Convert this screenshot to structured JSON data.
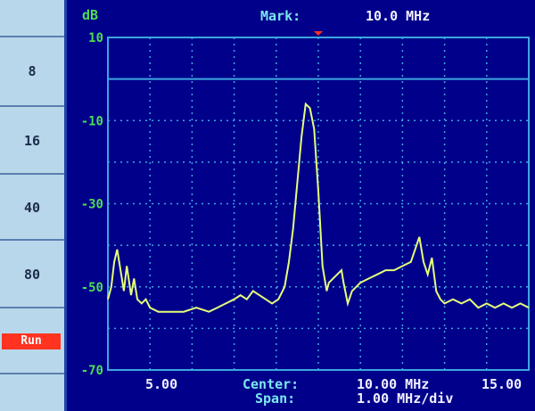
{
  "sidebar": {
    "items": [
      {
        "label": ""
      },
      {
        "label": "8"
      },
      {
        "label": "16"
      },
      {
        "label": "40"
      },
      {
        "label": "80"
      }
    ],
    "run_label": "Run"
  },
  "header": {
    "unit": "dB",
    "mark_label": "Mark:",
    "mark_value": "10.0 MHz"
  },
  "footer": {
    "x_left": "5.00",
    "center_label": "Center:",
    "center_value": "10.00 MHz",
    "x_right": "15.00",
    "span_label": "Span:",
    "span_value": "1.00 MHz/div"
  },
  "colors": {
    "background": "#00008a",
    "trace": "#e6ff7a",
    "grid": "#3ea6e0",
    "axis_label": "#4ddc55",
    "panel": "#b9d7ea",
    "run": "#ff3320"
  },
  "chart_data": {
    "type": "line",
    "ylim": [
      -70,
      10
    ],
    "xlim": [
      5,
      15
    ],
    "y_tick_labels": [
      "10",
      "-10",
      "-30",
      "-50",
      "-70"
    ],
    "y_ticks": [
      10,
      -10,
      -30,
      -50,
      -70
    ],
    "reference_level": 0,
    "marker_x": 10.0,
    "grid": true,
    "series": [
      {
        "x": [
          5.0,
          5.08,
          5.15,
          5.22,
          5.3,
          5.38,
          5.45,
          5.55,
          5.62,
          5.7,
          5.8,
          5.9,
          6.0,
          6.2,
          6.5,
          6.8,
          7.1,
          7.4,
          7.6,
          7.8,
          8.0,
          8.15,
          8.3,
          8.45,
          8.6,
          8.75,
          8.9,
          9.05,
          9.2,
          9.3,
          9.4,
          9.5,
          9.6,
          9.7,
          9.8,
          9.9,
          10.0,
          10.1,
          10.2,
          10.25,
          10.35,
          10.45,
          10.55,
          10.6,
          10.7,
          10.8,
          10.9,
          11.0,
          11.2,
          11.4,
          11.6,
          11.8,
          12.0,
          12.2,
          12.4,
          12.5,
          12.6,
          12.7,
          12.8,
          12.9,
          13.0,
          13.2,
          13.4,
          13.6,
          13.8,
          14.0,
          14.2,
          14.4,
          14.6,
          14.8,
          15.0
        ],
        "y": [
          -53,
          -50,
          -44,
          -41,
          -46,
          -51,
          -45,
          -52,
          -48,
          -53,
          -54,
          -53,
          -55,
          -56,
          -56,
          -56,
          -55,
          -56,
          -55,
          -54,
          -53,
          -52,
          -53,
          -51,
          -52,
          -53,
          -54,
          -53,
          -50,
          -44,
          -36,
          -25,
          -14,
          -6,
          -7,
          -12,
          -27,
          -45,
          -51,
          -49,
          -48,
          -47,
          -46,
          -49,
          -54,
          -51,
          -50,
          -49,
          -48,
          -47,
          -46,
          -46,
          -45,
          -44,
          -38,
          -44,
          -47,
          -43,
          -51,
          -53,
          -54,
          -53,
          -54,
          -53,
          -55,
          -54,
          -55,
          -54,
          -55,
          -54,
          -55
        ]
      }
    ]
  }
}
